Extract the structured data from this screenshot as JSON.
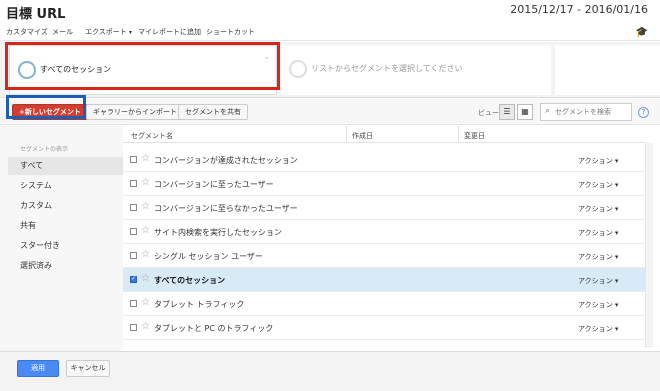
{
  "header": {
    "title": "目標 URL",
    "date_range": "2015/12/17 - 2016/01/16"
  },
  "toolbar": {
    "items": [
      "カスタマイズ",
      "メール",
      "エクスポート",
      "マイレポートに追加",
      "ショートカット"
    ],
    "export_caret": "▾",
    "help_icon": "graduation-cap-icon"
  },
  "segments": {
    "selected": "すべてのセッション",
    "placeholder": "リストからセグメントを選択してください"
  },
  "actions": {
    "new_segment": "+新しいセグメント",
    "import_gallery": "ギャラリーからインポート",
    "share_segment": "セグメントを共有",
    "view_label": "ビュー",
    "search_placeholder": "セグメントを検索",
    "help": "?"
  },
  "sidebar": {
    "heading": "セグメントの表示",
    "items": [
      "すべて",
      "システム",
      "カスタム",
      "共有",
      "スター付き",
      "選択済み"
    ],
    "active_index": 0
  },
  "table": {
    "columns": [
      "セグメント名",
      "作成日",
      "変更日"
    ],
    "rows": [
      {
        "name": "コンバージョンが達成されたセッション",
        "action": "アクション ▾",
        "checked": false
      },
      {
        "name": "コンバージョンに至ったユーザー",
        "action": "アクション ▾",
        "checked": false
      },
      {
        "name": "コンバージョンに至らなかったユーザー",
        "action": "アクション ▾",
        "checked": false
      },
      {
        "name": "サイト内検索を実行したセッション",
        "action": "アクション ▾",
        "checked": false
      },
      {
        "name": "シングル セッション ユーザー",
        "action": "アクション ▾",
        "checked": false
      },
      {
        "name": "すべてのセッション",
        "action": "アクション ▾",
        "checked": true
      },
      {
        "name": "タブレット トラフィック",
        "action": "アクション ▾",
        "checked": false
      },
      {
        "name": "タブレットと PC のトラフィック",
        "action": "アクション ▾",
        "checked": false
      }
    ]
  },
  "footer": {
    "apply": "適用",
    "cancel": "キャンセル"
  },
  "colors": {
    "new_segment_bg": "#d23f31",
    "apply_bg": "#4a8af4",
    "selected_row_bg": "#d9eaf7",
    "red_outline": "#d8261b",
    "blue_outline": "#1d5fb5"
  }
}
